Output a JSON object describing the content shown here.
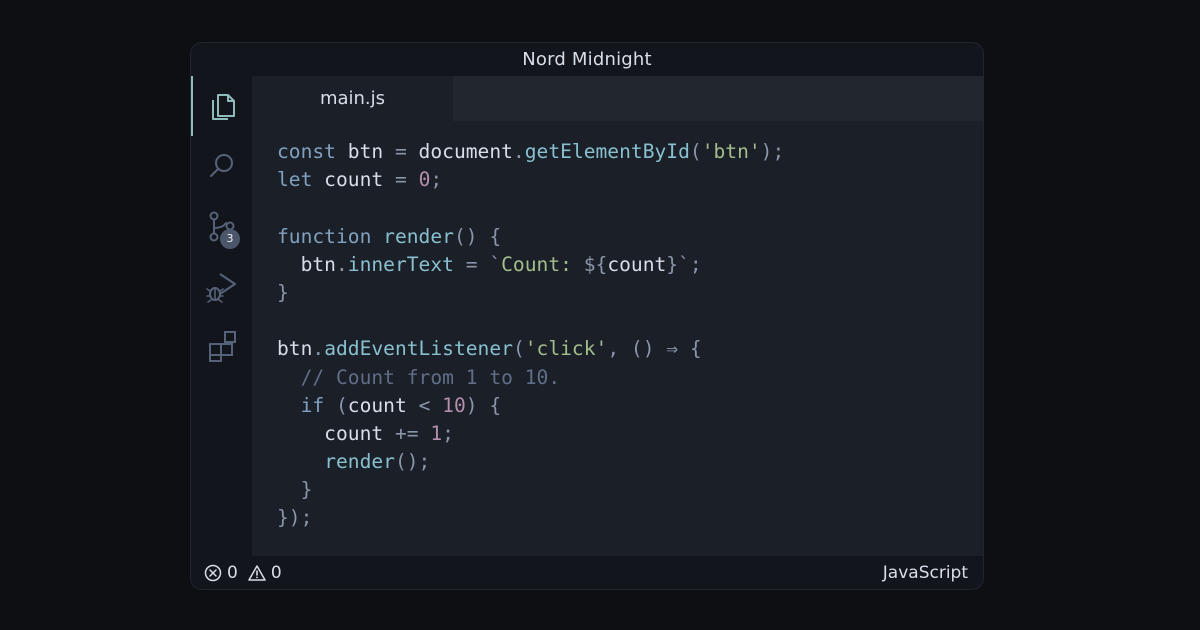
{
  "window": {
    "title": "Nord Midnight"
  },
  "activitybar": {
    "items": [
      {
        "icon": "files-icon",
        "active": true
      },
      {
        "icon": "search-icon",
        "active": false
      },
      {
        "icon": "source-control-icon",
        "active": false,
        "badge": "3"
      },
      {
        "icon": "run-debug-icon",
        "active": false
      },
      {
        "icon": "extensions-icon",
        "active": false
      }
    ]
  },
  "editor": {
    "tab_label": "main.js",
    "language": "JavaScript",
    "code_lines": [
      [
        {
          "type": "keyword",
          "text": "const"
        },
        {
          "type": "text",
          "text": " btn "
        },
        {
          "type": "punct",
          "text": "="
        },
        {
          "type": "text",
          "text": " document"
        },
        {
          "type": "punct",
          "text": "."
        },
        {
          "type": "function",
          "text": "getElementById"
        },
        {
          "type": "punct",
          "text": "("
        },
        {
          "type": "string",
          "text": "'btn'"
        },
        {
          "type": "punct",
          "text": ");"
        }
      ],
      [
        {
          "type": "keyword",
          "text": "let"
        },
        {
          "type": "text",
          "text": " count "
        },
        {
          "type": "punct",
          "text": "="
        },
        {
          "type": "text",
          "text": " "
        },
        {
          "type": "number",
          "text": "0"
        },
        {
          "type": "punct",
          "text": ";"
        }
      ],
      [],
      [
        {
          "type": "keyword",
          "text": "function"
        },
        {
          "type": "text",
          "text": " "
        },
        {
          "type": "function",
          "text": "render"
        },
        {
          "type": "punct",
          "text": "() {"
        }
      ],
      [
        {
          "type": "text",
          "text": "  btn"
        },
        {
          "type": "punct",
          "text": "."
        },
        {
          "type": "property",
          "text": "innerText"
        },
        {
          "type": "text",
          "text": " "
        },
        {
          "type": "punct",
          "text": "="
        },
        {
          "type": "text",
          "text": " "
        },
        {
          "type": "punct",
          "text": "`"
        },
        {
          "type": "string",
          "text": "Count: "
        },
        {
          "type": "punct",
          "text": "${"
        },
        {
          "type": "text",
          "text": "count"
        },
        {
          "type": "punct",
          "text": "}`;"
        }
      ],
      [
        {
          "type": "punct",
          "text": "}"
        }
      ],
      [],
      [
        {
          "type": "text",
          "text": "btn"
        },
        {
          "type": "punct",
          "text": "."
        },
        {
          "type": "function",
          "text": "addEventListener"
        },
        {
          "type": "punct",
          "text": "("
        },
        {
          "type": "string",
          "text": "'click'"
        },
        {
          "type": "punct",
          "text": ", () ⇒ {"
        }
      ],
      [
        {
          "type": "comment",
          "text": "  // Count from 1 to 10."
        }
      ],
      [
        {
          "type": "text",
          "text": "  "
        },
        {
          "type": "keyword",
          "text": "if"
        },
        {
          "type": "text",
          "text": " "
        },
        {
          "type": "punct",
          "text": "("
        },
        {
          "type": "text",
          "text": "count "
        },
        {
          "type": "punct",
          "text": "<"
        },
        {
          "type": "text",
          "text": " "
        },
        {
          "type": "number",
          "text": "10"
        },
        {
          "type": "punct",
          "text": ") {"
        }
      ],
      [
        {
          "type": "text",
          "text": "    count "
        },
        {
          "type": "punct",
          "text": "+="
        },
        {
          "type": "text",
          "text": " "
        },
        {
          "type": "number",
          "text": "1"
        },
        {
          "type": "punct",
          "text": ";"
        }
      ],
      [
        {
          "type": "text",
          "text": "    "
        },
        {
          "type": "function",
          "text": "render"
        },
        {
          "type": "punct",
          "text": "();"
        }
      ],
      [
        {
          "type": "punct",
          "text": "  }"
        }
      ],
      [
        {
          "type": "punct",
          "text": "});"
        }
      ]
    ]
  },
  "statusbar": {
    "errors": "0",
    "warnings": "0",
    "language": "JavaScript"
  },
  "colors": {
    "background": "#0d0f13",
    "window": "#12151b",
    "editor": "#1b1f27",
    "tabs": "#22262e",
    "keyword": "#81a1c1",
    "function": "#88c0d0",
    "string": "#a3be8c",
    "number": "#b48ead",
    "comment": "#616e88",
    "text": "#d8dee9"
  }
}
